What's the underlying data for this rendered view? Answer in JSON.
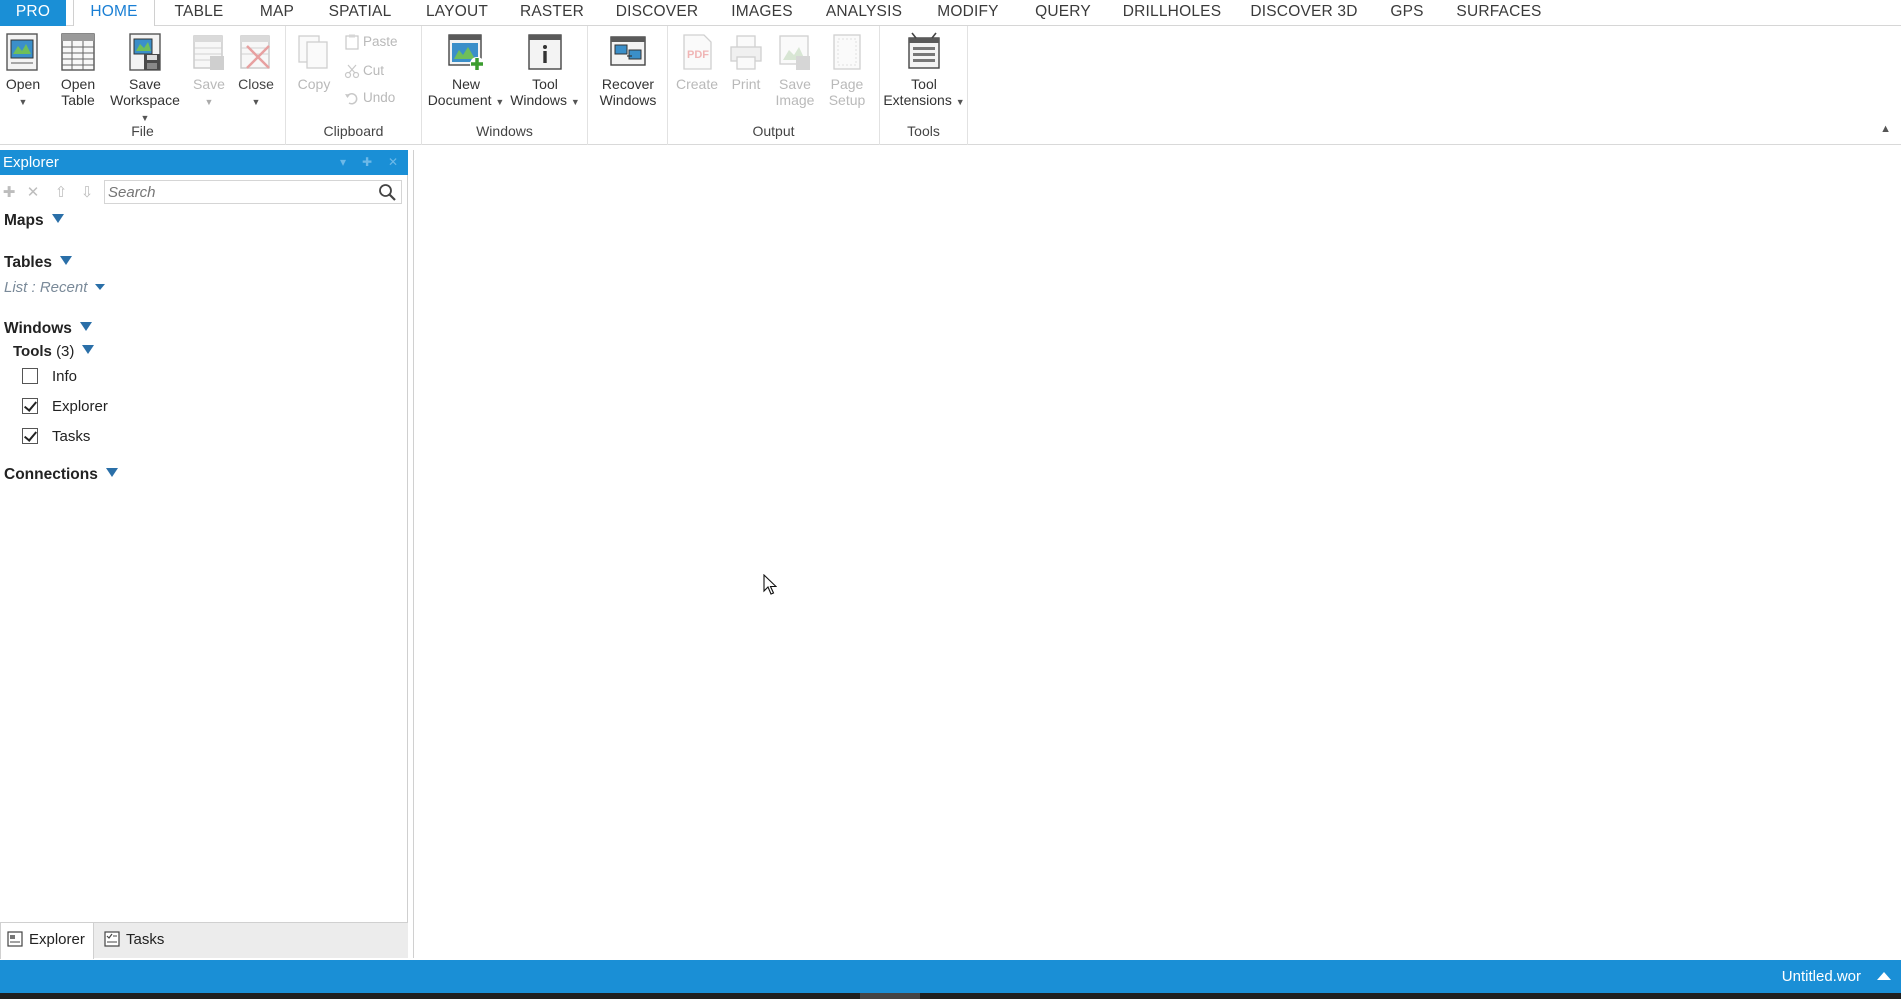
{
  "ribbon_tabs": [
    {
      "label": "PRO"
    },
    {
      "label": "HOME"
    },
    {
      "label": "TABLE"
    },
    {
      "label": "MAP"
    },
    {
      "label": "SPATIAL"
    },
    {
      "label": "LAYOUT"
    },
    {
      "label": "RASTER"
    },
    {
      "label": "DISCOVER"
    },
    {
      "label": "IMAGES"
    },
    {
      "label": "ANALYSIS"
    },
    {
      "label": "MODIFY"
    },
    {
      "label": "QUERY"
    },
    {
      "label": "DRILLHOLES"
    },
    {
      "label": "DISCOVER 3D"
    },
    {
      "label": "GPS"
    },
    {
      "label": "SURFACES"
    }
  ],
  "active_tab": "HOME",
  "ribbon": {
    "file": {
      "label": "File",
      "open": {
        "line1": "Open"
      },
      "open_table": {
        "line1": "Open",
        "line2": "Table"
      },
      "save_workspace": {
        "line1": "Save",
        "line2": "Workspace"
      },
      "save": {
        "line1": "Save"
      },
      "close": {
        "line1": "Close"
      }
    },
    "clipboard": {
      "label": "Clipboard",
      "copy": "Copy",
      "paste": "Paste",
      "cut": "Cut",
      "undo": "Undo"
    },
    "windows": {
      "label": "Windows",
      "new_document": {
        "line1": "New",
        "line2": "Document"
      },
      "tool_windows": {
        "line1": "Tool",
        "line2": "Windows"
      },
      "recover_windows": {
        "line1": "Recover",
        "line2": "Windows"
      }
    },
    "output": {
      "label": "Output",
      "create": "Create",
      "print": "Print",
      "save_image": {
        "line1": "Save",
        "line2": "Image"
      },
      "page_setup": {
        "line1": "Page",
        "line2": "Setup"
      }
    },
    "tools": {
      "label": "Tools",
      "tool_extensions": {
        "line1": "Tool",
        "line2": "Extensions"
      }
    }
  },
  "explorer": {
    "title": "Explorer",
    "search_placeholder": "Search",
    "maps_label": "Maps",
    "tables_label": "Tables",
    "list_recent": "List : Recent",
    "windows_label": "Windows",
    "tools_label": "Tools",
    "tools_count": "(3)",
    "tool_items": [
      {
        "label": "Info",
        "checked": false
      },
      {
        "label": "Explorer",
        "checked": true
      },
      {
        "label": "Tasks",
        "checked": true
      }
    ],
    "connections_label": "Connections",
    "bottom_tabs": [
      {
        "label": "Explorer",
        "active": true
      },
      {
        "label": "Tasks",
        "active": false
      }
    ]
  },
  "statusbar": {
    "file_name": "Untitled.wor"
  },
  "colors": {
    "accent": "#1a8fd6",
    "active_tab_text": "#1a7fd4",
    "disabled_text": "#b9b9b9"
  }
}
